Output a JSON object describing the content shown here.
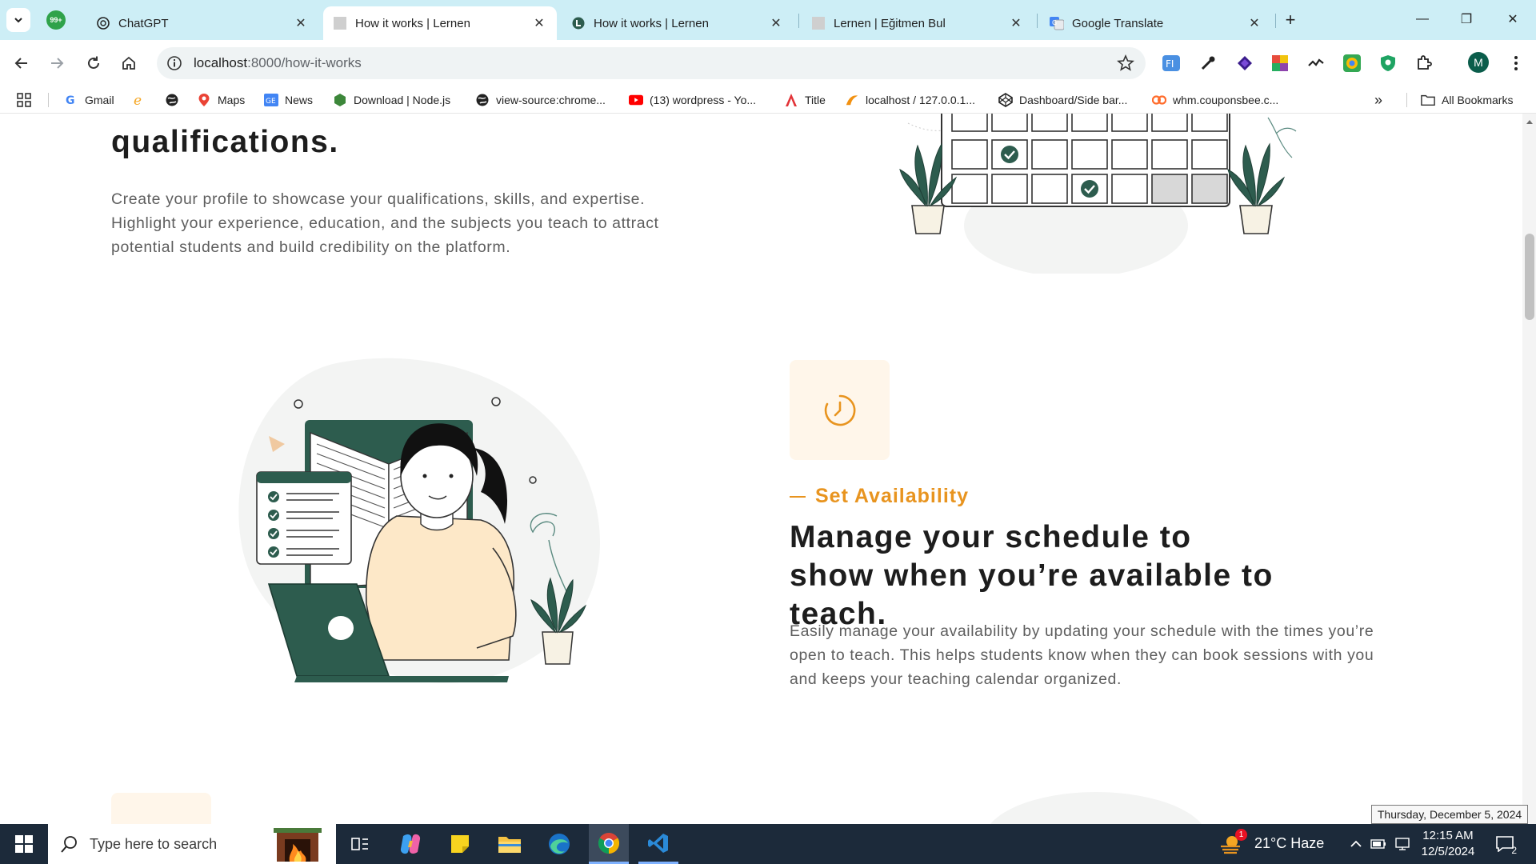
{
  "browser": {
    "tabs": [
      {
        "title": "ChatGPT",
        "icon": "chatgpt-icon",
        "active": false
      },
      {
        "title": "How it works | Lernen",
        "icon": "blank-page-icon",
        "active": true
      },
      {
        "title": "How it works | Lernen",
        "icon": "lernen-icon",
        "active": false
      },
      {
        "title": "Lernen | Eğitmen Bul",
        "icon": "blank-page-icon",
        "active": false
      },
      {
        "title": "Google Translate",
        "icon": "google-translate-icon",
        "active": false
      }
    ],
    "pinned_badge": "99+",
    "url_host": "localhost",
    "url_path": ":8000/how-it-works",
    "profile_initial": "M",
    "bookmarks": [
      {
        "label": "Gmail",
        "icon": "google-icon"
      },
      {
        "label": "",
        "icon": "ie-icon"
      },
      {
        "label": "",
        "icon": "globe-icon"
      },
      {
        "label": "Maps",
        "icon": "maps-pin-icon"
      },
      {
        "label": "News",
        "icon": "google-news-icon"
      },
      {
        "label": "Download | Node.js",
        "icon": "nodejs-icon"
      },
      {
        "label": "view-source:chrome...",
        "icon": "globe-icon"
      },
      {
        "label": "(13) wordpress - Yo...",
        "icon": "youtube-icon"
      },
      {
        "label": "Title",
        "icon": "angular-icon"
      },
      {
        "label": "localhost / 127.0.0.1...",
        "icon": "phpmyadmin-icon"
      },
      {
        "label": "Dashboard/Side bar...",
        "icon": "codepen-icon"
      },
      {
        "label": "whm.couponsbee.c...",
        "icon": "cpanel-icon"
      }
    ],
    "all_bookmarks_label": "All Bookmarks"
  },
  "page": {
    "section1": {
      "heading_tail": "qualifications.",
      "body": "Create your profile to showcase your qualifications, skills, and expertise. Highlight your experience, education, and the subjects you teach to attract potential students and build credibility on the platform."
    },
    "section2": {
      "eyebrow": "Set Availability",
      "heading": "Manage your schedule to show when you’re available to teach.",
      "body": "Easily manage your availability by updating your schedule with the times you’re open to teach. This helps students know when they can book sessions with you and keeps your teaching calendar organized."
    },
    "accent_color": "#e8941f",
    "illustration_green": "#2d5c4e"
  },
  "taskbar": {
    "search_placeholder": "Type here to search",
    "weather": "21°C  Haze",
    "weather_alert_count": "1",
    "time": "12:15 AM",
    "date": "12/5/2024",
    "date_tooltip": "Thursday, December 5, 2024",
    "notification_count": "2"
  }
}
